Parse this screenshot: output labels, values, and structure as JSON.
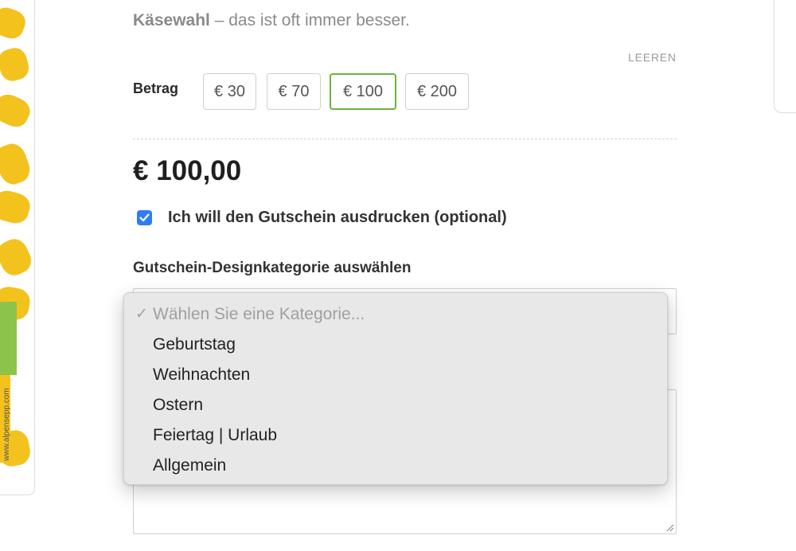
{
  "intro": {
    "bold_text": "Käsewahl",
    "rest_text": " – das ist oft immer besser."
  },
  "clear_label": "LEEREN",
  "amount": {
    "label": "Betrag",
    "options": [
      "€ 30",
      "€ 70",
      "€ 100",
      "€ 200"
    ],
    "selected": "€ 100"
  },
  "price": "€ 100,00",
  "print_option": {
    "checked": true,
    "label": "Ich will den Gutschein ausdrucken (optional)"
  },
  "design_category": {
    "label": "Gutschein-Designkategorie auswählen",
    "placeholder": "Wählen Sie eine Kategorie...",
    "options": [
      "Geburtstag",
      "Weihnachten",
      "Ostern",
      "Feiertag | Urlaub",
      "Allgemein"
    ]
  },
  "left_preview": {
    "url_text": "www.alpensepp.com"
  },
  "colors": {
    "accent_green": "#6bb33a",
    "checkbox_blue": "#2f7cf6",
    "brand_yellow": "#f3c21d"
  }
}
